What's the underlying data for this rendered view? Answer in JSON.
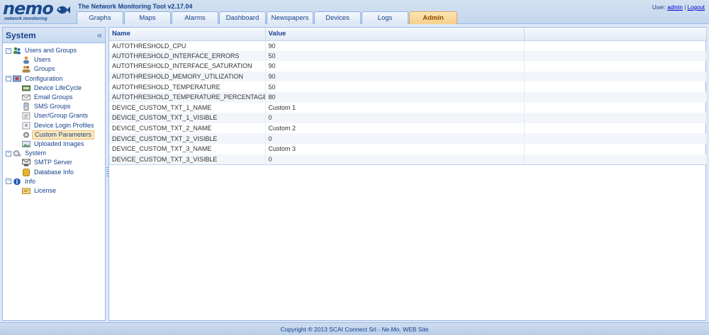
{
  "logo": {
    "word": "nemo",
    "sub": "network monitoring"
  },
  "app_title": "The Network Monitoring Tool v2.17.04",
  "user": {
    "prefix": "User:",
    "name": "admin",
    "separator": "|",
    "logout": "Logout"
  },
  "tabs": [
    {
      "label": "Graphs",
      "active": false
    },
    {
      "label": "Maps",
      "active": false
    },
    {
      "label": "Alarms",
      "active": false
    },
    {
      "label": "Dashboard",
      "active": false
    },
    {
      "label": "Newspapers",
      "active": false
    },
    {
      "label": "Devices",
      "active": false
    },
    {
      "label": "Logs",
      "active": false
    },
    {
      "label": "Admin",
      "active": true
    }
  ],
  "left_panel": {
    "title": "System",
    "collapse_glyph": "«",
    "tree": [
      {
        "label": "Users and Groups",
        "icon": "users-groups-icon",
        "children": [
          {
            "label": "Users",
            "icon": "user-icon"
          },
          {
            "label": "Groups",
            "icon": "group-icon"
          }
        ]
      },
      {
        "label": "Configuration",
        "icon": "configuration-icon",
        "children": [
          {
            "label": "Device LifeCycle",
            "icon": "lifecycle-icon"
          },
          {
            "label": "Email Groups",
            "icon": "email-icon"
          },
          {
            "label": "SMS Groups",
            "icon": "sms-icon"
          },
          {
            "label": "User/Group Grants",
            "icon": "grants-icon"
          },
          {
            "label": "Device Login Profiles",
            "icon": "login-profile-icon"
          },
          {
            "label": "Custom Parameters",
            "icon": "custom-parameters-icon",
            "selected": true
          },
          {
            "label": "Uploaded Images",
            "icon": "images-icon"
          }
        ]
      },
      {
        "label": "System",
        "icon": "system-icon",
        "children": [
          {
            "label": "SMTP Server",
            "icon": "smtp-icon"
          },
          {
            "label": "Database Info",
            "icon": "database-icon"
          }
        ]
      },
      {
        "label": "Info",
        "icon": "info-icon",
        "children": [
          {
            "label": "License",
            "icon": "license-icon"
          }
        ]
      }
    ]
  },
  "grid": {
    "columns": [
      "Name",
      "Value"
    ],
    "rows": [
      {
        "name": "AUTOTHRESHOLD_CPU",
        "value": "90"
      },
      {
        "name": "AUTOTHRESHOLD_INTERFACE_ERRORS",
        "value": "50"
      },
      {
        "name": "AUTOTHRESHOLD_INTERFACE_SATURATION",
        "value": "90"
      },
      {
        "name": "AUTOTHRESHOLD_MEMORY_UTILIZATION",
        "value": "90"
      },
      {
        "name": "AUTOTHRESHOLD_TEMPERATURE",
        "value": "50"
      },
      {
        "name": "AUTOTHRESHOLD_TEMPERATURE_PERCENTAGE",
        "value": "80"
      },
      {
        "name": "DEVICE_CUSTOM_TXT_1_NAME",
        "value": "Custom 1"
      },
      {
        "name": "DEVICE_CUSTOM_TXT_1_VISIBLE",
        "value": "0"
      },
      {
        "name": "DEVICE_CUSTOM_TXT_2_NAME",
        "value": "Custom 2"
      },
      {
        "name": "DEVICE_CUSTOM_TXT_2_VISIBLE",
        "value": "0"
      },
      {
        "name": "DEVICE_CUSTOM_TXT_3_NAME",
        "value": "Custom 3"
      },
      {
        "name": "DEVICE_CUSTOM_TXT_3_VISIBLE",
        "value": "0"
      }
    ]
  },
  "footer": "Copyright ® 2013 SCAI Connect Srl - Ne.Mo. WEB Site",
  "colors": {
    "accent": "#15428b",
    "border": "#99bbe8",
    "active_tab": "#f6cf8a",
    "selected": "#fde8b8"
  }
}
